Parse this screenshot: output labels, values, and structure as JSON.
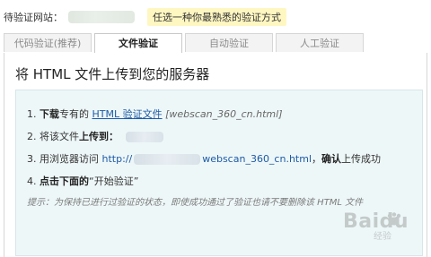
{
  "top": {
    "label": "待验证网站：",
    "hint": "任选一种你最熟悉的验证方式"
  },
  "tabs": [
    {
      "label": "代码验证(推荐)"
    },
    {
      "label": "文件验证"
    },
    {
      "label": "自动验证"
    },
    {
      "label": "人工验证"
    }
  ],
  "panel": {
    "title": "将 HTML 文件上传到您的服务器",
    "steps": {
      "s1": {
        "num": "1.",
        "bold": "下载",
        "mid": "专有的",
        "link": "HTML 验证文件",
        "file": "[webscan_360_cn.html]"
      },
      "s2": {
        "num": "2.",
        "pre": "将该文件",
        "bold": "上传到："
      },
      "s3": {
        "num": "3.",
        "pre": "用浏览器访问",
        "proto": "http://",
        "file": "webscan_360_cn.html",
        "comma": "，",
        "bold": "确认",
        "post": "上传成功"
      },
      "s4": {
        "num": "4.",
        "bold": "点击下面的",
        "post": "“开始验证”"
      }
    },
    "note": "提示：为保持已进行过验证的状态，即使成功通过了验证也请不要删除该 HTML 文件"
  },
  "watermark": {
    "text": "Baidu",
    "sub": "经验"
  }
}
